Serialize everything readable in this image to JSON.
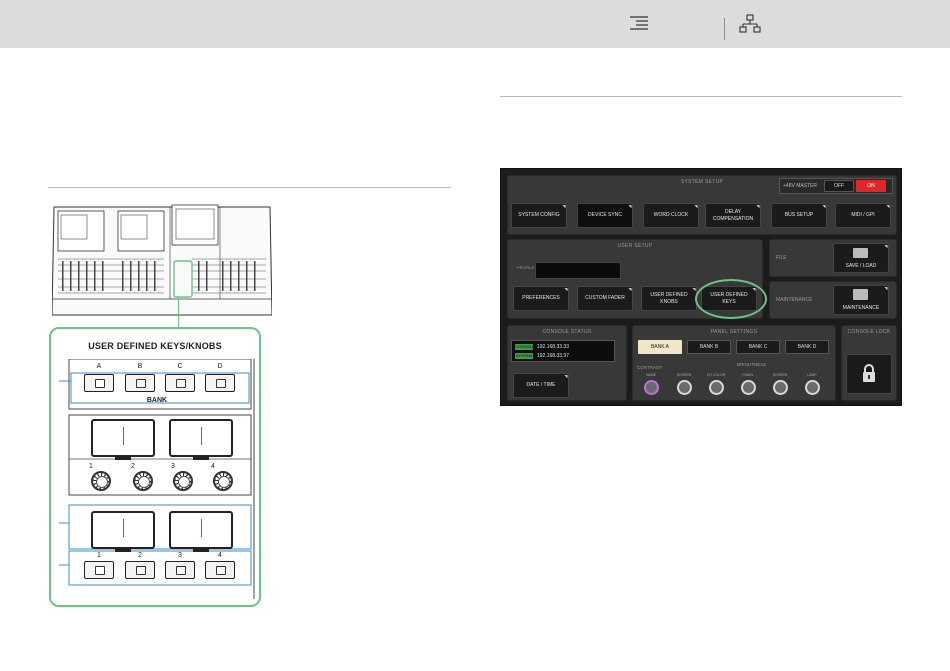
{
  "toolbar": {
    "icons": [
      "menu-lines-icon",
      "sitemap-icon"
    ]
  },
  "illustration": {
    "panel_title": "USER DEFINED KEYS/KNOBS",
    "bank_keys": [
      "A",
      "B",
      "C",
      "D"
    ],
    "bank_label": "BANK",
    "knob_numbers": [
      "1",
      "2",
      "3",
      "4"
    ],
    "key_numbers": [
      "1",
      "2",
      "3",
      "4"
    ]
  },
  "screen": {
    "system_setup": {
      "title": "SYSTEM SETUP",
      "phantom_label": "+48V MASTER",
      "off_label": "OFF",
      "on_label": "ON",
      "buttons": [
        "SYSTEM CONFIG",
        "DEVICE SYNC",
        "WORD CLOCK",
        "DELAY\nCOMPENSATION",
        "BUS SETUP",
        "MIDI / GPI"
      ]
    },
    "user_setup": {
      "title": "USER SETUP",
      "profile_label": "PROFILE",
      "buttons": [
        "PREFERENCES",
        "CUSTOM FADER",
        "USER DEFINED\nKNOBS",
        "USER DEFINED\nKEYS"
      ]
    },
    "file": {
      "label": "FILE",
      "button": "SAVE / LOAD"
    },
    "maintenance": {
      "label": "MAINTENANCE",
      "button": "MAINTENANCE"
    },
    "console_status": {
      "title": "CONSOLE STATUS",
      "rows": [
        {
          "tag": "CONSOLE",
          "ip": "192.168.33.33"
        },
        {
          "tag": "SYSTEM",
          "ip": "192.168.33.97"
        }
      ],
      "date_button": "DATE / TIME"
    },
    "panel_settings": {
      "title": "PANEL SETTINGS",
      "banks": [
        "BANK A",
        "BANK B",
        "BANK C",
        "BANK D"
      ],
      "contrast_label": "CONTRAST",
      "brightness_label": "BRIGHTNESS",
      "knob_labels": [
        "NAME",
        "SCREEN",
        "CH COLOR",
        "PANEL",
        "SCREEN",
        "LAMP"
      ]
    },
    "console_lock": {
      "title": "CONSOLE LOCK"
    }
  },
  "colors": {
    "accent_green": "#6ac48a",
    "active_red": "#e0262b",
    "bank_active": "#f2e6c8"
  }
}
